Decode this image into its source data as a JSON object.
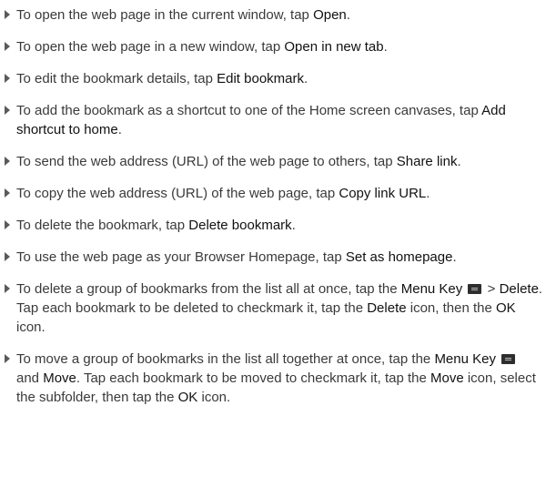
{
  "items": [
    {
      "pre": "To open the web page in the current window, tap ",
      "em": "Open",
      "post": "."
    },
    {
      "pre": "To open the web page in a new window, tap ",
      "em": "Open in new tab",
      "post": "."
    },
    {
      "pre": "To edit the bookmark details, tap ",
      "em": "Edit bookmark",
      "post": "."
    },
    {
      "pre": "To add the bookmark as a shortcut to one of the Home screen canvases, tap ",
      "em": "Add shortcut to home",
      "post": "."
    },
    {
      "pre": "To send the web address (URL) of the web page to others, tap ",
      "em": "Share link",
      "post": "."
    },
    {
      "pre": "To copy the web address (URL) of the web page, tap ",
      "em": "Copy link URL",
      "post": "."
    },
    {
      "pre": "To delete the bookmark, tap ",
      "em": "Delete bookmark",
      "post": "."
    },
    {
      "pre": "To use the web page as your Browser Homepage, tap ",
      "em": "Set as homepage",
      "post": "."
    }
  ],
  "item9": {
    "t1": "To delete a group of bookmarks from the list all at once, tap the ",
    "e1": "Menu Key",
    "t2": " > ",
    "e2": "Delete",
    "t3": ". Tap each bookmark to be deleted to checkmark it, tap the ",
    "e3": "Delete",
    "t4": " icon, then the ",
    "e4": "OK",
    "t5": " icon."
  },
  "item10": {
    "t1": "To move a group of bookmarks in the list all together at once, tap the ",
    "e1": "Menu Key",
    "t2": " and ",
    "e2": "Move",
    "t3": ". Tap each bookmark to be moved to checkmark it, tap the ",
    "e3": "Move",
    "t4": " icon, select the subfolder, then tap the ",
    "e4": "OK",
    "t5": " icon."
  }
}
